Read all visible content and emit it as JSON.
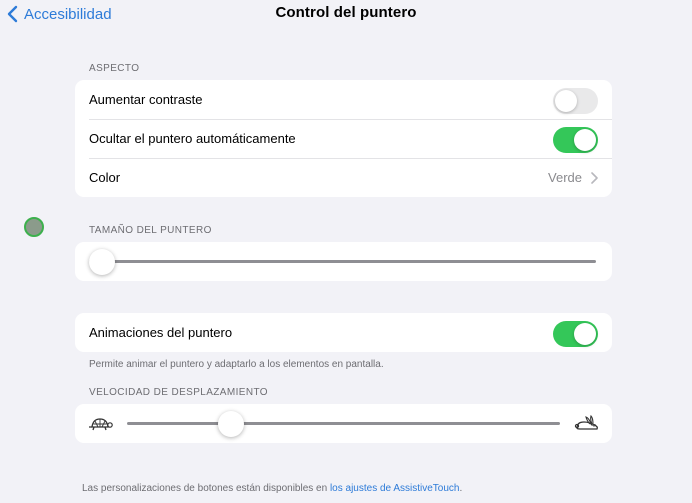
{
  "nav": {
    "back_label": "Accesibilidad",
    "title": "Control del puntero"
  },
  "aspecto": {
    "header": "ASPECTO",
    "rows": [
      {
        "label": "Aumentar contraste",
        "toggle": false
      },
      {
        "label": "Ocultar el puntero automáticamente",
        "toggle": true
      },
      {
        "label": "Color",
        "value": "Verde"
      }
    ]
  },
  "tamano": {
    "header": "TAMAÑO DEL PUNTERO",
    "slider_fraction": 0.0
  },
  "animaciones": {
    "label": "Animaciones del puntero",
    "toggle": true,
    "footnote": "Permite animar el puntero y adaptarlo a los elementos en pantalla."
  },
  "velocidad": {
    "header": "VELOCIDAD DE DESPLAZAMIENTO",
    "slider_fraction": 0.24,
    "slow_icon": "turtle-icon",
    "fast_icon": "rabbit-icon"
  },
  "footer": {
    "text": "Las personalizaciones de botones están disponibles en ",
    "link": "los ajustes de AssistiveTouch",
    "suffix": "."
  },
  "colors": {
    "accent": "#2d7bd8",
    "toggle_on": "#34c759",
    "pointer": "#3db04d"
  }
}
